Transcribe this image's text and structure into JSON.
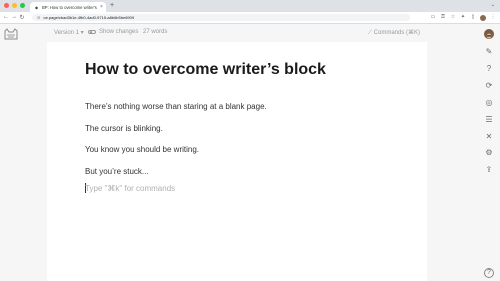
{
  "browser": {
    "tab_title": "BP: How to overcome writer's bl...",
    "tab_close": "×",
    "new_tab": "+",
    "tab_dropdown": "⌄",
    "url": "oe.page/cbad3b1e-4fb0-4ad0-9715-a8b6b5be6909",
    "nav": {
      "back": "←",
      "forward": "→",
      "reload": "↻"
    },
    "lock": "⊙"
  },
  "icons": {
    "back": "arrow-left-icon",
    "forward": "arrow-right-icon",
    "reload": "reload-icon",
    "logo": "cat-logo-icon",
    "share": "share-icon",
    "help": "help-icon"
  },
  "doc_toolbar": {
    "version": "Version 1 ▾",
    "show_changes": "Show changes",
    "word_count": "27 words",
    "commands": "Commands (⌘K)"
  },
  "document": {
    "title": "How to overcome writer’s block",
    "paragraphs": [
      "There’s nothing worse than staring at a blank page.",
      "The cursor is blinking.",
      "You know you should be writing.",
      "But you’re stuck..."
    ],
    "placeholder": "Type \"⌘k\" for commands"
  },
  "right_rail": {
    "icons": [
      "pen-edit-icon",
      "question-icon",
      "refresh-circle-icon",
      "compass-icon",
      "list-icon",
      "tools-icon",
      "gear-icon",
      "share-icon"
    ],
    "help": "?"
  },
  "colors": {
    "page_bg": "#ffffff",
    "app_bg": "#f6f6f6",
    "muted_text": "#9a9a9a"
  }
}
